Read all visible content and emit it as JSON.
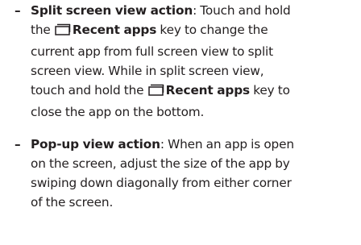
{
  "items": [
    {
      "bullet": "–",
      "title": "Split screen view action",
      "lines": [
        ": Touch and hold",
        "the",
        "Recent apps",
        " key to change the",
        "current app from full screen view to split",
        "screen view. While in split screen view,",
        "touch and hold the",
        "Recent apps",
        " key to",
        "close the app on the bottom."
      ],
      "icon": "recent-apps-icon"
    },
    {
      "bullet": "–",
      "title": "Pop-up view action",
      "lines": [
        ": When an app is open",
        "on the screen, adjust the size of the app by",
        "swiping down diagonally from either corner",
        "of the screen."
      ]
    }
  ],
  "colors": {
    "text": "#231f20"
  }
}
